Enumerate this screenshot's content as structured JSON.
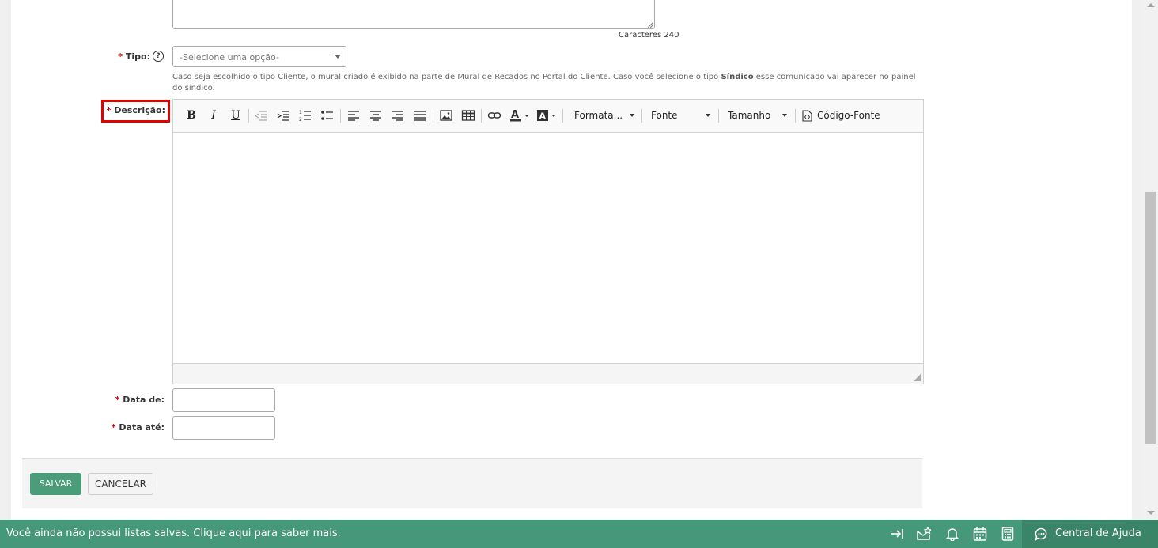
{
  "form": {
    "char_count_label": "Caracteres 240",
    "tipo": {
      "required_mark": "*",
      "label": "Tipo:",
      "help_glyph": "?",
      "placeholder": "-Selecione uma opção-",
      "hint_before": "Caso seja escolhido o tipo Cliente, o mural criado é exibido na parte de Mural de Recados no Portal do Cliente. Caso você selecione o tipo ",
      "hint_bold": "Síndico",
      "hint_after": " esse comunicado vai aparecer no painel do síndico."
    },
    "descricao": {
      "required_mark": "*",
      "label": "Descrição:"
    },
    "data_de": {
      "required_mark": "*",
      "label": "Data de:",
      "value": ""
    },
    "data_ate": {
      "required_mark": "*",
      "label": "Data até:",
      "value": ""
    }
  },
  "editor": {
    "bold": "B",
    "italic": "I",
    "underline": "U",
    "format_dropdown": "Formata...",
    "font_dropdown": "Fonte",
    "size_dropdown": "Tamanho",
    "source_button": "Código-Fonte"
  },
  "actions": {
    "save": "SALVAR",
    "cancel": "CANCELAR"
  },
  "bottom_bar": {
    "message": "Você ainda não possui listas salvas. Clique aqui para saber mais.",
    "help_center": "Central de Ajuda",
    "icons": [
      "arrow-to-right-icon",
      "envelope-star-icon",
      "bell-icon",
      "calendar-icon",
      "calculator-icon",
      "chat-icon"
    ]
  },
  "colors": {
    "primary_green": "#45997a",
    "save_button": "#4a9d78",
    "highlight_red": "#e30000"
  }
}
